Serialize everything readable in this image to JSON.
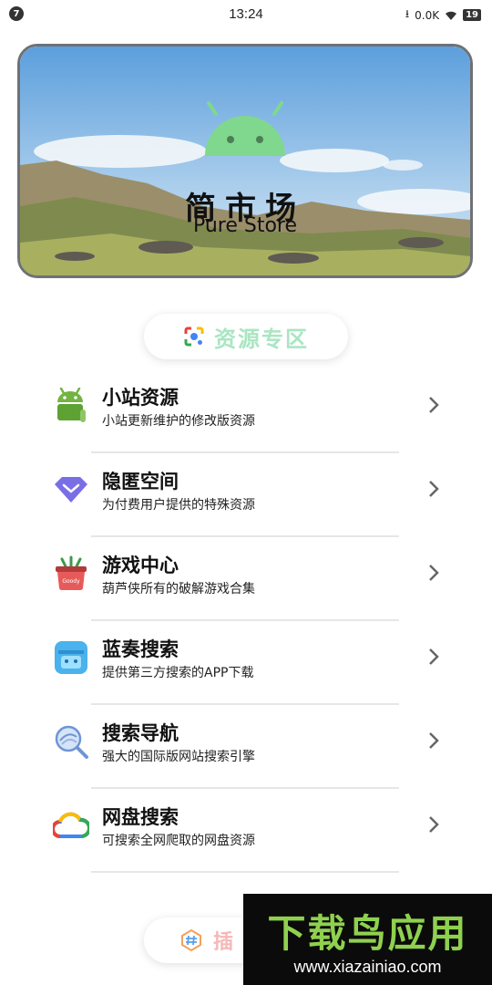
{
  "status_bar": {
    "time": "13:24",
    "notification_badge": "7",
    "network_speed": "0.0K",
    "battery": "19"
  },
  "banner": {
    "title_cn": "简市场",
    "title_en": "Pure Store"
  },
  "resource_section": {
    "label": "资源专区"
  },
  "menu": [
    {
      "title": "小站资源",
      "subtitle": "小站更新维护的修改版资源",
      "icon": "android-icon"
    },
    {
      "title": "隐匿空间",
      "subtitle": "为付费用户提供的特殊资源",
      "icon": "diamond-icon"
    },
    {
      "title": "游戏中心",
      "subtitle": "葫芦侠所有的破解游戏合集",
      "icon": "game-basket-icon"
    },
    {
      "title": "蓝奏搜索",
      "subtitle": "提供第三方搜索的APP下载",
      "icon": "robot-icon"
    },
    {
      "title": "搜索导航",
      "subtitle": "强大的国际版网站搜索引擎",
      "icon": "search-globe-icon"
    },
    {
      "title": "网盘搜索",
      "subtitle": "可搜索全网爬取的网盘资源",
      "icon": "cloud-icon"
    }
  ],
  "plugin_section": {
    "label": "插"
  },
  "watermark": {
    "title": "下载鸟应用",
    "url": "www.xiazainiao.com"
  }
}
